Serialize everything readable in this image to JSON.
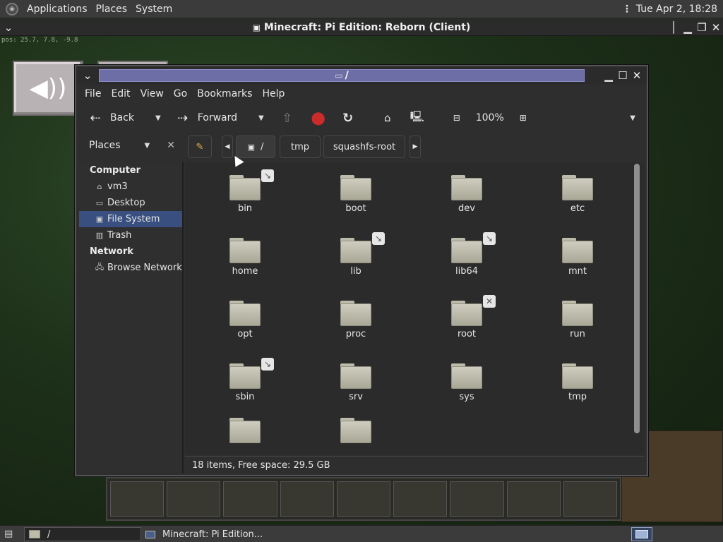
{
  "top_panel": {
    "menus": [
      "Applications",
      "Places",
      "System"
    ],
    "clock": "Tue Apr  2, 18:28"
  },
  "game_window": {
    "title": "Minecraft: Pi Edition: Reborn (Client)",
    "debug_text": "pos: 25.7, 7.8, -9.8"
  },
  "file_manager": {
    "title": "/",
    "menu": [
      "File",
      "Edit",
      "View",
      "Go",
      "Bookmarks",
      "Help"
    ],
    "toolbar": {
      "back_label": "Back",
      "forward_label": "Forward",
      "zoom_level": "100%"
    },
    "places_label": "Places",
    "breadcrumbs": [
      "/",
      "tmp",
      "squashfs-root"
    ],
    "sidebar": {
      "computer_header": "Computer",
      "computer_items": [
        {
          "label": "vm3",
          "icon": "home-folder-icon"
        },
        {
          "label": "Desktop",
          "icon": "desktop-folder-icon"
        },
        {
          "label": "File System",
          "icon": "drive-icon",
          "selected": true
        },
        {
          "label": "Trash",
          "icon": "trash-icon"
        }
      ],
      "network_header": "Network",
      "network_items": [
        {
          "label": "Browse Network",
          "icon": "network-icon"
        }
      ]
    },
    "files": [
      {
        "name": "bin",
        "emblem": "symlink"
      },
      {
        "name": "boot",
        "emblem": ""
      },
      {
        "name": "dev",
        "emblem": ""
      },
      {
        "name": "etc",
        "emblem": ""
      },
      {
        "name": "home",
        "emblem": ""
      },
      {
        "name": "lib",
        "emblem": "symlink"
      },
      {
        "name": "lib64",
        "emblem": "symlink"
      },
      {
        "name": "mnt",
        "emblem": ""
      },
      {
        "name": "opt",
        "emblem": ""
      },
      {
        "name": "proc",
        "emblem": ""
      },
      {
        "name": "root",
        "emblem": "unreadable"
      },
      {
        "name": "run",
        "emblem": ""
      },
      {
        "name": "sbin",
        "emblem": "symlink"
      },
      {
        "name": "srv",
        "emblem": ""
      },
      {
        "name": "sys",
        "emblem": ""
      },
      {
        "name": "tmp",
        "emblem": ""
      },
      {
        "name": "",
        "emblem": ""
      },
      {
        "name": "",
        "emblem": ""
      }
    ],
    "status": "18 items, Free space: 29.5 GB"
  },
  "bottom_panel": {
    "task_file_manager": "/",
    "task_minecraft": "Minecraft: Pi Edition..."
  },
  "colors": {
    "selection": "#384f80",
    "title_active": "#6e6ea6",
    "panel": "#3b3b3b"
  }
}
